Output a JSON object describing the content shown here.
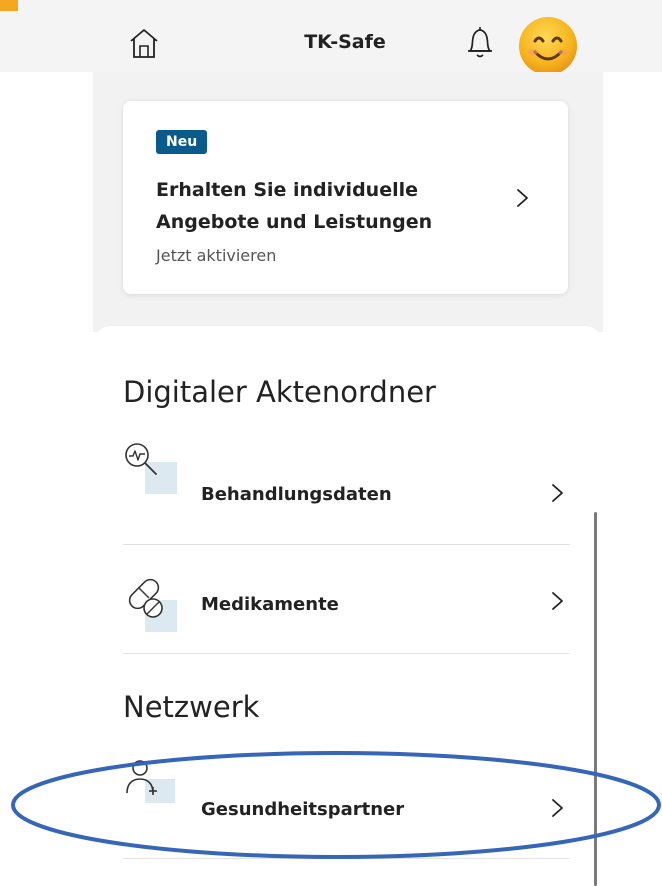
{
  "header": {
    "title": "TK-Safe",
    "home_icon": "home-icon",
    "notification_icon": "bell-icon",
    "avatar_icon": "smiley-avatar"
  },
  "promo": {
    "badge": "Neu",
    "title_line1": "Erhalten Sie individuelle",
    "title_line2": "Angebote und Leistungen",
    "subtitle": "Jetzt aktivieren"
  },
  "sections": {
    "digital_folder_title": "Digitaler Aktenordner",
    "network_title": "Netzwerk"
  },
  "items": {
    "treatment": {
      "label": "Behandlungsdaten",
      "icon": "magnifier-pulse-icon"
    },
    "medication": {
      "label": "Medikamente",
      "icon": "pills-icon"
    },
    "health_partners": {
      "label": "Gesundheitspartner",
      "icon": "person-plus-icon"
    }
  },
  "colors": {
    "badge_bg": "#0a5b8b",
    "icon_tint": "#dde9f1",
    "annotation": "#3566b8",
    "avatar": "#f5b81e"
  }
}
